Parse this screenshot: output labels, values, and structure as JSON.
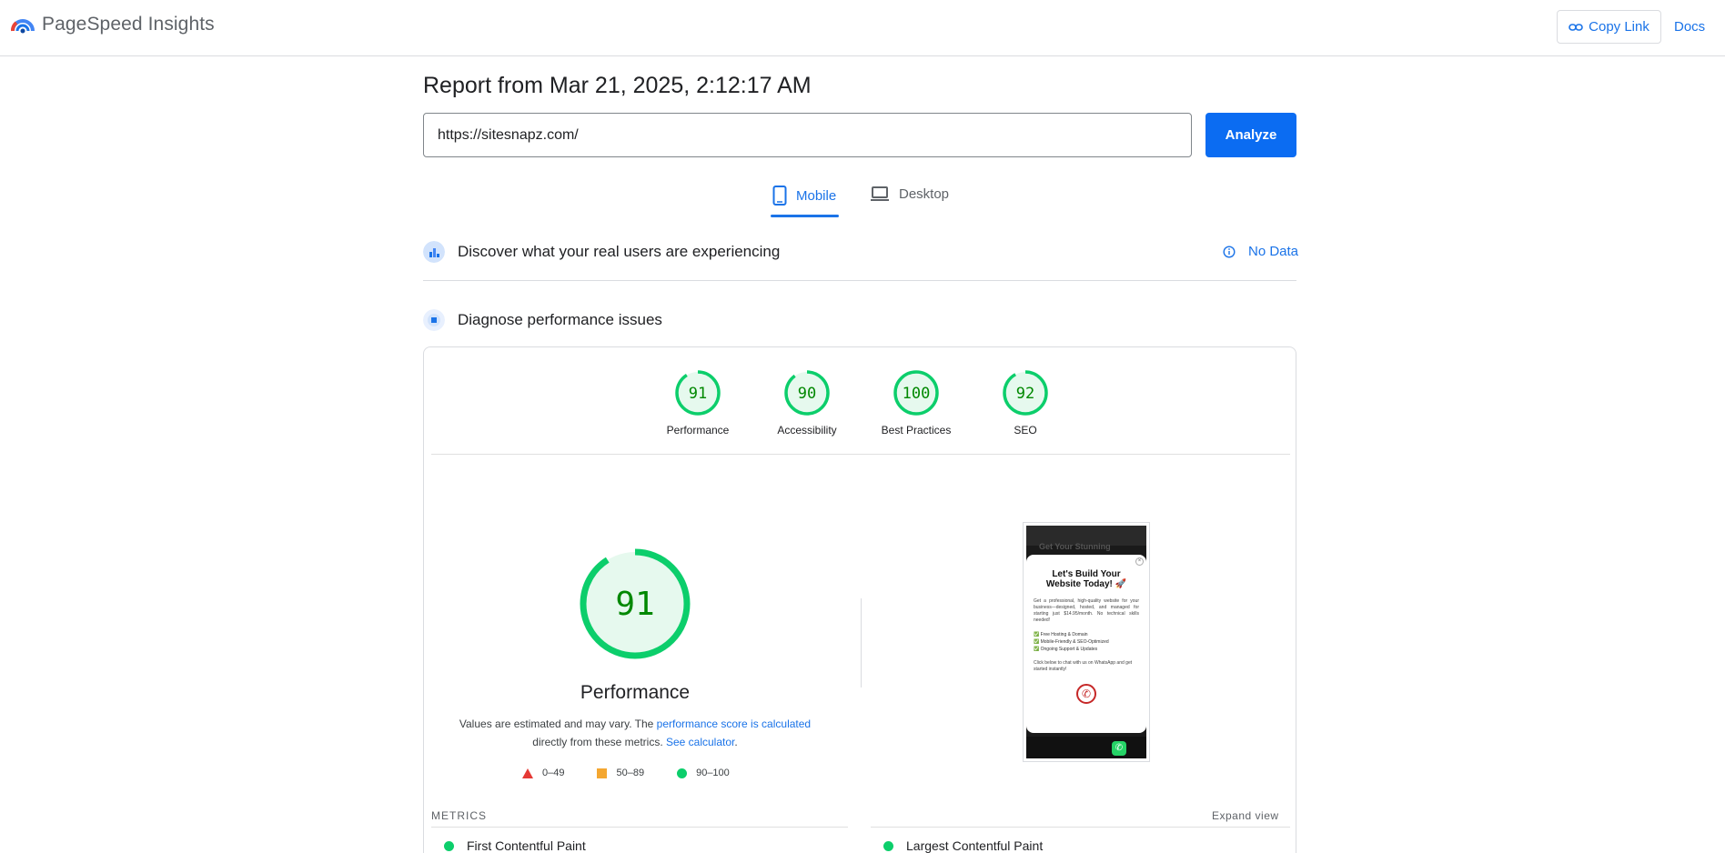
{
  "header": {
    "app_name": "PageSpeed Insights",
    "copy_link_label": "Copy Link",
    "docs_label": "Docs"
  },
  "report": {
    "title": "Report from Mar 21, 2025, 2:12:17 AM",
    "url_value": "https://sitesnapz.com/",
    "analyze_label": "Analyze"
  },
  "tabs": [
    {
      "label": "Mobile",
      "active": true,
      "icon": "smartphone-icon"
    },
    {
      "label": "Desktop",
      "active": false,
      "icon": "laptop-icon"
    }
  ],
  "field_data": {
    "title": "Discover what your real users are experiencing",
    "status": "No Data"
  },
  "lab_data": {
    "title": "Diagnose performance issues"
  },
  "scores": [
    {
      "label": "Performance",
      "value": "91"
    },
    {
      "label": "Accessibility",
      "value": "90"
    },
    {
      "label": "Best Practices",
      "value": "100"
    },
    {
      "label": "SEO",
      "value": "92"
    }
  ],
  "performance": {
    "score": "91",
    "title": "Performance",
    "note_prefix": "Values are estimated and may vary. The ",
    "note_link1": "performance score is calculated",
    "note_middle": " directly from these metrics. ",
    "note_link2": "See calculator",
    "note_suffix": "."
  },
  "legend": [
    {
      "shape": "triangle",
      "range": "0–49",
      "color": "#e53935"
    },
    {
      "shape": "square",
      "range": "50–89",
      "color": "#f4a731"
    },
    {
      "shape": "circle",
      "range": "90–100",
      "color": "#0cce6b"
    }
  ],
  "screenshot": {
    "headline": "Get Your Stunning",
    "modal_title": "Let's Build Your Website Today! 🚀",
    "modal_text": "Get a professional, high-quality website for your business—designed, hosted, and managed for starting just $14.95/month. No technical skills needed!",
    "list": [
      "✅ Free Hosting & Domain",
      "✅ Mobile-Friendly & SEO-Optimized",
      "✅ Ongoing Support & Updates"
    ],
    "cta": "Click below to chat with us on WhatsApp and get started instantly!"
  },
  "metrics": {
    "section_label": "METRICS",
    "expand_label": "Expand view",
    "items": [
      {
        "label": "First Contentful Paint",
        "status": "good"
      },
      {
        "label": "Largest Contentful Paint",
        "status": "good"
      }
    ]
  },
  "colors": {
    "accent": "#1a73e8",
    "analyze_bg": "#0b6cf2",
    "good": "#0cce6b",
    "good_text": "#008800",
    "good_fill": "#e6f9ee"
  }
}
